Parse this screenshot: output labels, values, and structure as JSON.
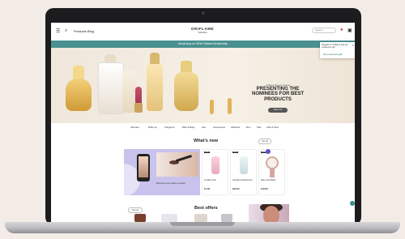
{
  "header": {
    "menu_icon": "hamburger-icon",
    "search_icon": "search-icon",
    "nav_links": [
      "Products",
      "Blog"
    ],
    "logo": "ORIFLAME",
    "logo_sub": "SWEDEN",
    "search_placeholder": "Search",
    "user_icon": "user-icon",
    "bag_icon": "bag-icon"
  },
  "promo_bar": {
    "text": "Introducing our NEW Oriflame Membership"
  },
  "popup": {
    "text": "Register to Oriflame and get a welcome gift",
    "link": "Get a welcome gift"
  },
  "hero": {
    "kicker": "Oriflame Beauty Awards",
    "title": "PRESENTING THE NOMINEES FOR BEST PRODUCTS",
    "button": "Vote now"
  },
  "categories": [
    "Skincare",
    "Make-up",
    "Fragrance",
    "Bath & Body",
    "Hair",
    "Accessories",
    "Wellness",
    "Men",
    "Kids",
    "Gifts & Sets"
  ],
  "whats_new": {
    "title": "What's new",
    "see_all": "See all",
    "promo_text": "Discover new make-up looks",
    "products": [
      {
        "badge": "NEW",
        "name": "Lip Balm Pink",
        "price": "£7.00"
      },
      {
        "badge": "NEW",
        "name": "Giordani Gold Essenza",
        "price": "£25.00"
      },
      {
        "badge": "NEW",
        "name": "Rose Gold Watch",
        "price": "£19.00"
      }
    ]
  },
  "best_offers": {
    "title": "Best offers",
    "see_all": "See all"
  },
  "colors": {
    "promo_bar": "#4a9090",
    "accent": "#6a4cc6",
    "chat": "#3a8f8f"
  }
}
